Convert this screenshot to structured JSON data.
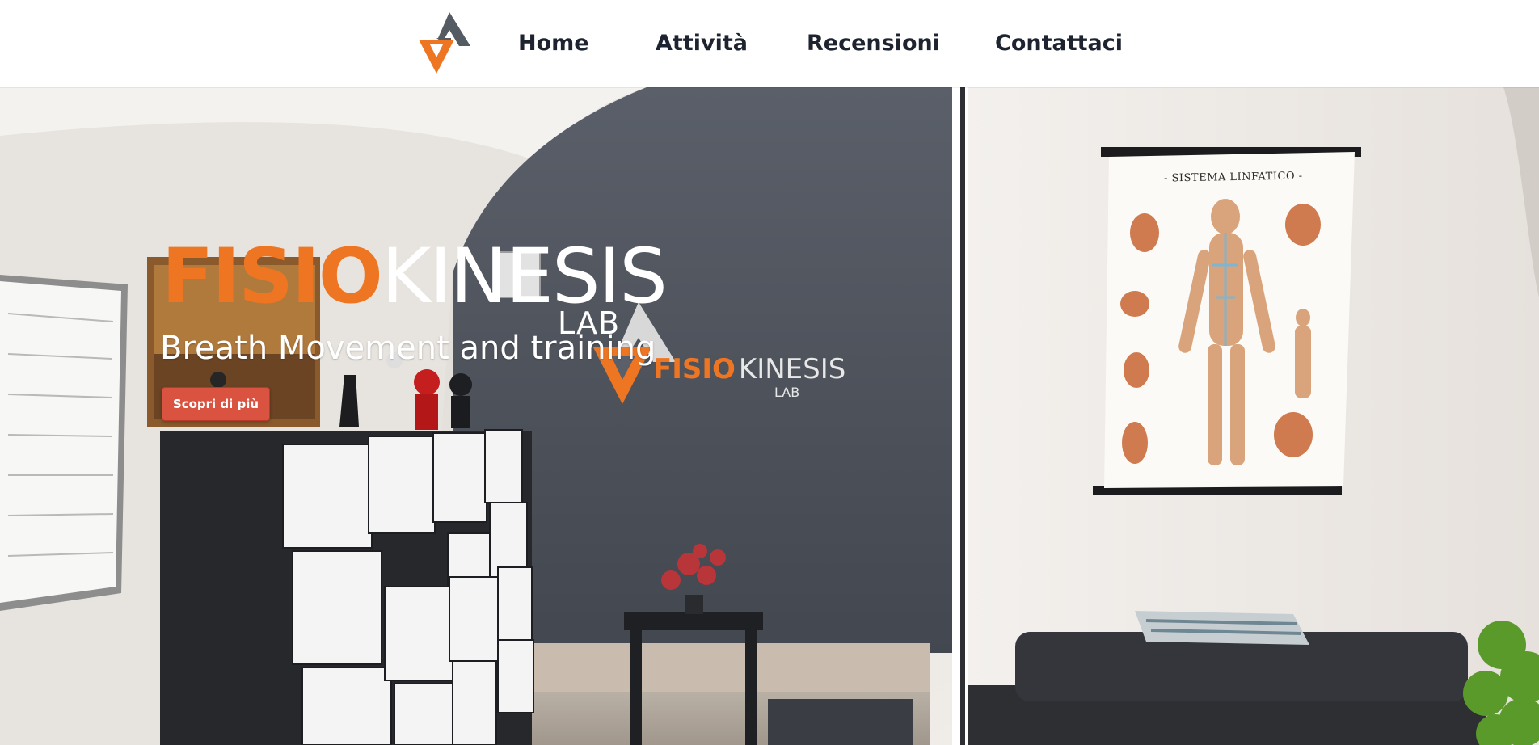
{
  "nav": {
    "logo_icon": "fisiokinesis-logo-icon",
    "links": [
      "Home",
      "Attività",
      "Recensioni",
      "Contattaci"
    ]
  },
  "hero": {
    "title_primary": "FISIO",
    "title_secondary": "KINESIS",
    "title_suffix": "LAB",
    "subtitle": "Breath Movement and training",
    "cta_label": "Scopri di più"
  },
  "wall_logo": {
    "text_primary": "FISIO",
    "text_secondary": "KINESIS",
    "text_suffix": "LAB"
  },
  "poster": {
    "title": "- SISTEMA LINFATICO -"
  },
  "colors": {
    "accent_orange": "#ee7623",
    "nav_text": "#1e2330",
    "cta_red": "#d95340",
    "wall_gray": "#4a4f59"
  }
}
